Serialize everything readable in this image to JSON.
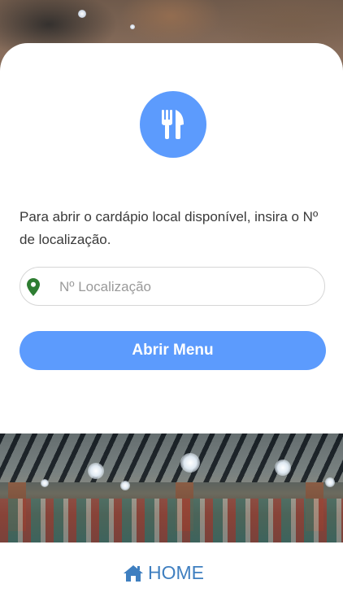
{
  "card": {
    "logo_icon": "fork-knife-icon",
    "prompt_text": "Para abrir o cardápio local disponível, insira o Nº de localização.",
    "location_input": {
      "placeholder": "Nº Localização",
      "value": "",
      "icon": "map-pin-icon",
      "icon_color": "#2e7d32"
    },
    "open_button_label": "Abrir Menu"
  },
  "footer": {
    "home_icon": "home-icon",
    "home_label": "HOME"
  },
  "colors": {
    "accent": "#5c9bfd",
    "link": "#3f7fc0",
    "text": "#3a3a3a"
  }
}
